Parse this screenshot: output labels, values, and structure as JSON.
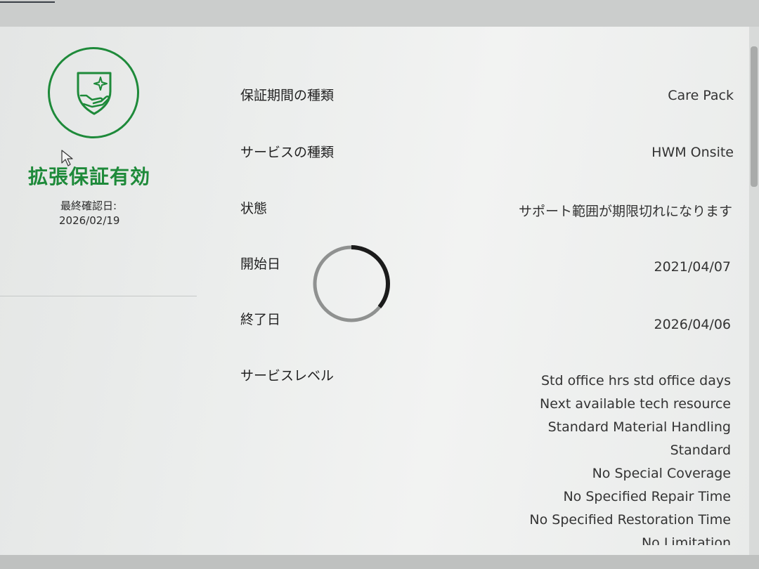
{
  "status": {
    "title": "拡張保証有効",
    "last_check_label": "最終確認日:",
    "last_check_date": "2026/02/19",
    "icon": "shield-hand-icon",
    "accent_color": "#1e8a3a"
  },
  "details": {
    "warranty_type": {
      "label": "保証期間の種類",
      "value": "Care Pack"
    },
    "service_type": {
      "label": "サービスの種類",
      "value": "HWM Onsite"
    },
    "state": {
      "label": "状態",
      "value": "サポート範囲が期限切れになります"
    },
    "start_date": {
      "label": "開始日",
      "value": "2021/04/07"
    },
    "end_date": {
      "label": "終了日",
      "value": "2026/04/06"
    },
    "service_level": {
      "label": "サービスレベル",
      "items": [
        "Std office hrs std office days",
        "Next available tech resource",
        "Standard Material Handling",
        "Standard",
        "No Special Coverage",
        "No Specified Repair Time",
        "No Specified Restoration Time",
        "No Limitation"
      ]
    }
  }
}
